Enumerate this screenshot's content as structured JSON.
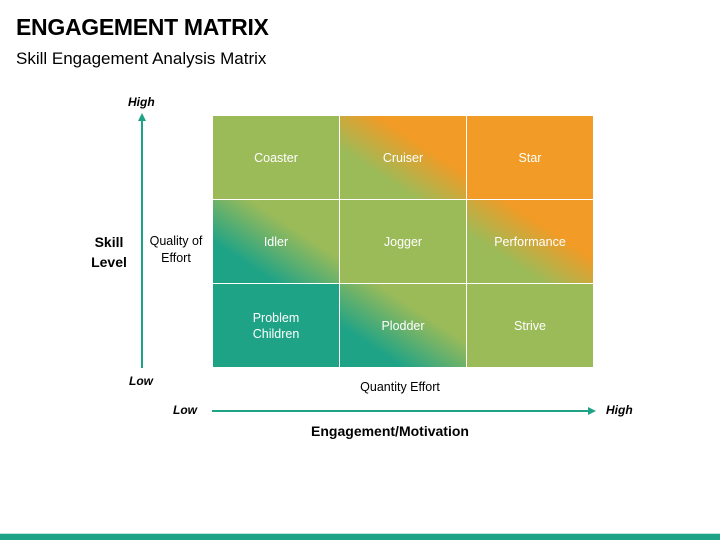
{
  "title": "ENGAGEMENT MATRIX",
  "subtitle": "Skill Engagement Analysis Matrix",
  "colors": {
    "green": "#9bbb59",
    "orange": "#f29b26",
    "teal": "#1fa386",
    "axis": "#1fa386"
  },
  "y_axis": {
    "label_line1": "Skill",
    "label_line2": "Level",
    "sub_label_line1": "Quality of",
    "sub_label_line2": "Effort",
    "high": "High",
    "low": "Low"
  },
  "x_axis": {
    "label": "Engagement/Motivation",
    "sub_label": "Quantity Effort",
    "low": "Low",
    "high": "High"
  },
  "matrix": {
    "rows": [
      [
        {
          "line1": "Coaster",
          "line2": "",
          "style": "green"
        },
        {
          "line1": "Cruiser",
          "line2": "",
          "style": "green-orange"
        },
        {
          "line1": "Star",
          "line2": "",
          "style": "orange"
        }
      ],
      [
        {
          "line1": "Idler",
          "line2": "",
          "style": "teal-green"
        },
        {
          "line1": "Jogger",
          "line2": "",
          "style": "green"
        },
        {
          "line1": "Performance",
          "line2": "",
          "style": "green-orange"
        }
      ],
      [
        {
          "line1": "Problem",
          "line2": "Children",
          "style": "teal"
        },
        {
          "line1": "Plodder",
          "line2": "",
          "style": "teal-green"
        },
        {
          "line1": "Strive",
          "line2": "",
          "style": "green"
        }
      ]
    ]
  }
}
